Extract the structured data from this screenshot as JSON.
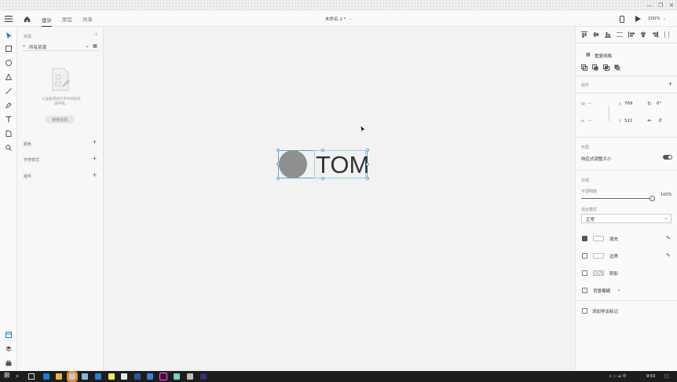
{
  "topbar": {
    "tabs": [
      "设计",
      "原型",
      "共享"
    ],
    "doc_title": "未命名-1 *",
    "zoom": "200%"
  },
  "assets": {
    "section_title": "资源",
    "search_placeholder": "所有资源",
    "empty_hint": "从画板或组元件中添加资源开始。",
    "empty_button": "链接资源",
    "sections": [
      "颜色",
      "字符样式",
      "组件"
    ]
  },
  "canvas": {
    "text": "TOM",
    "circle_color": "#8f8f8f"
  },
  "right": {
    "repeat_grid": "重复网格",
    "component_label": "组件",
    "w_label": "W",
    "w_value": "—",
    "h_label": "H",
    "h_value": "—",
    "x_label": "X",
    "x_value": "769",
    "y_label": "Y",
    "y_value": "511",
    "rotation": "0°",
    "layout_label": "布局",
    "responsive": "响应式调整大小",
    "appearance_label": "外观",
    "opacity_label": "不透明度",
    "opacity_value": "100%",
    "blend_label": "混合模式",
    "blend_value": "正常",
    "fill": "填充",
    "border": "边界",
    "shadow": "阴影",
    "bg_blur": "背景模糊",
    "export": "添加导出标记"
  },
  "taskbar": {
    "time": "9:53"
  },
  "colors": {
    "accent": "#5ba6c7",
    "taskbar": "#1d1d1d"
  }
}
